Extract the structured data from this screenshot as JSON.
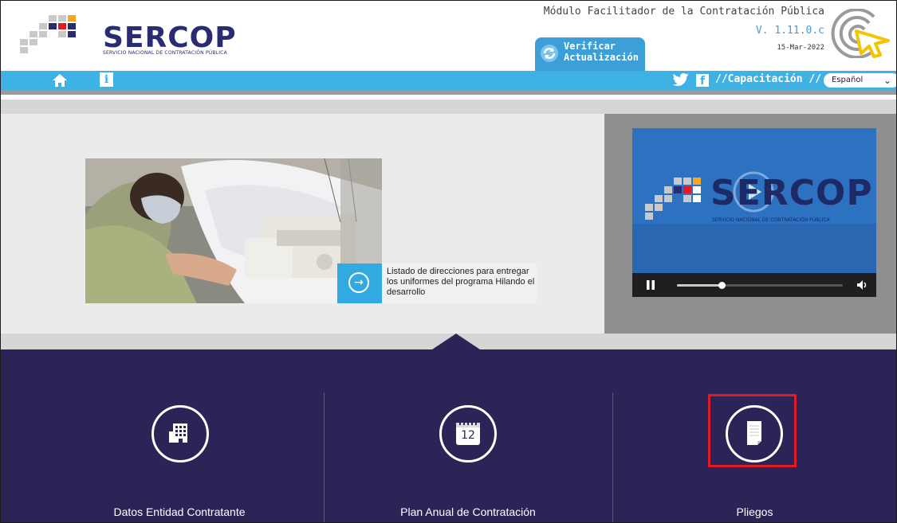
{
  "header": {
    "logo_text": "SERCOP",
    "logo_subtitle": "SERVICIO NACIONAL DE CONTRATACIÓN PÚBLICA",
    "module_title": "Módulo Facilitador de la Contratación Pública",
    "version": "V. 1.11.0.c",
    "date": "15-Mar-2022",
    "verify_label_line1": "Verificar",
    "verify_label_line2": "Actualización"
  },
  "navbar": {
    "capacitacion": "//Capacitación //",
    "language": "Español",
    "info_label": "i",
    "facebook_label": "f"
  },
  "banner": {
    "caption": "Listado de direcciones para entregar los uniformes del programa Hilando el desarrollo"
  },
  "video": {
    "logo_text": "SERCOP",
    "logo_subtitle": "SERVICIO NACIONAL DE CONTRATACIÓN PÚBLICA",
    "progress_fraction": 0.27
  },
  "cards": [
    {
      "label": "Datos Entidad Contratante",
      "icon": "building-icon"
    },
    {
      "label": "Plan Anual de Contratación",
      "icon": "calendar-icon",
      "icon_text": "12"
    },
    {
      "label": "Pliegos",
      "icon": "document-icon"
    }
  ],
  "colors": {
    "brand_navy": "#2a2c73",
    "nav_blue": "#3fb2e5",
    "dark_panel": "#2a2556",
    "highlight_red": "#e21b24"
  }
}
